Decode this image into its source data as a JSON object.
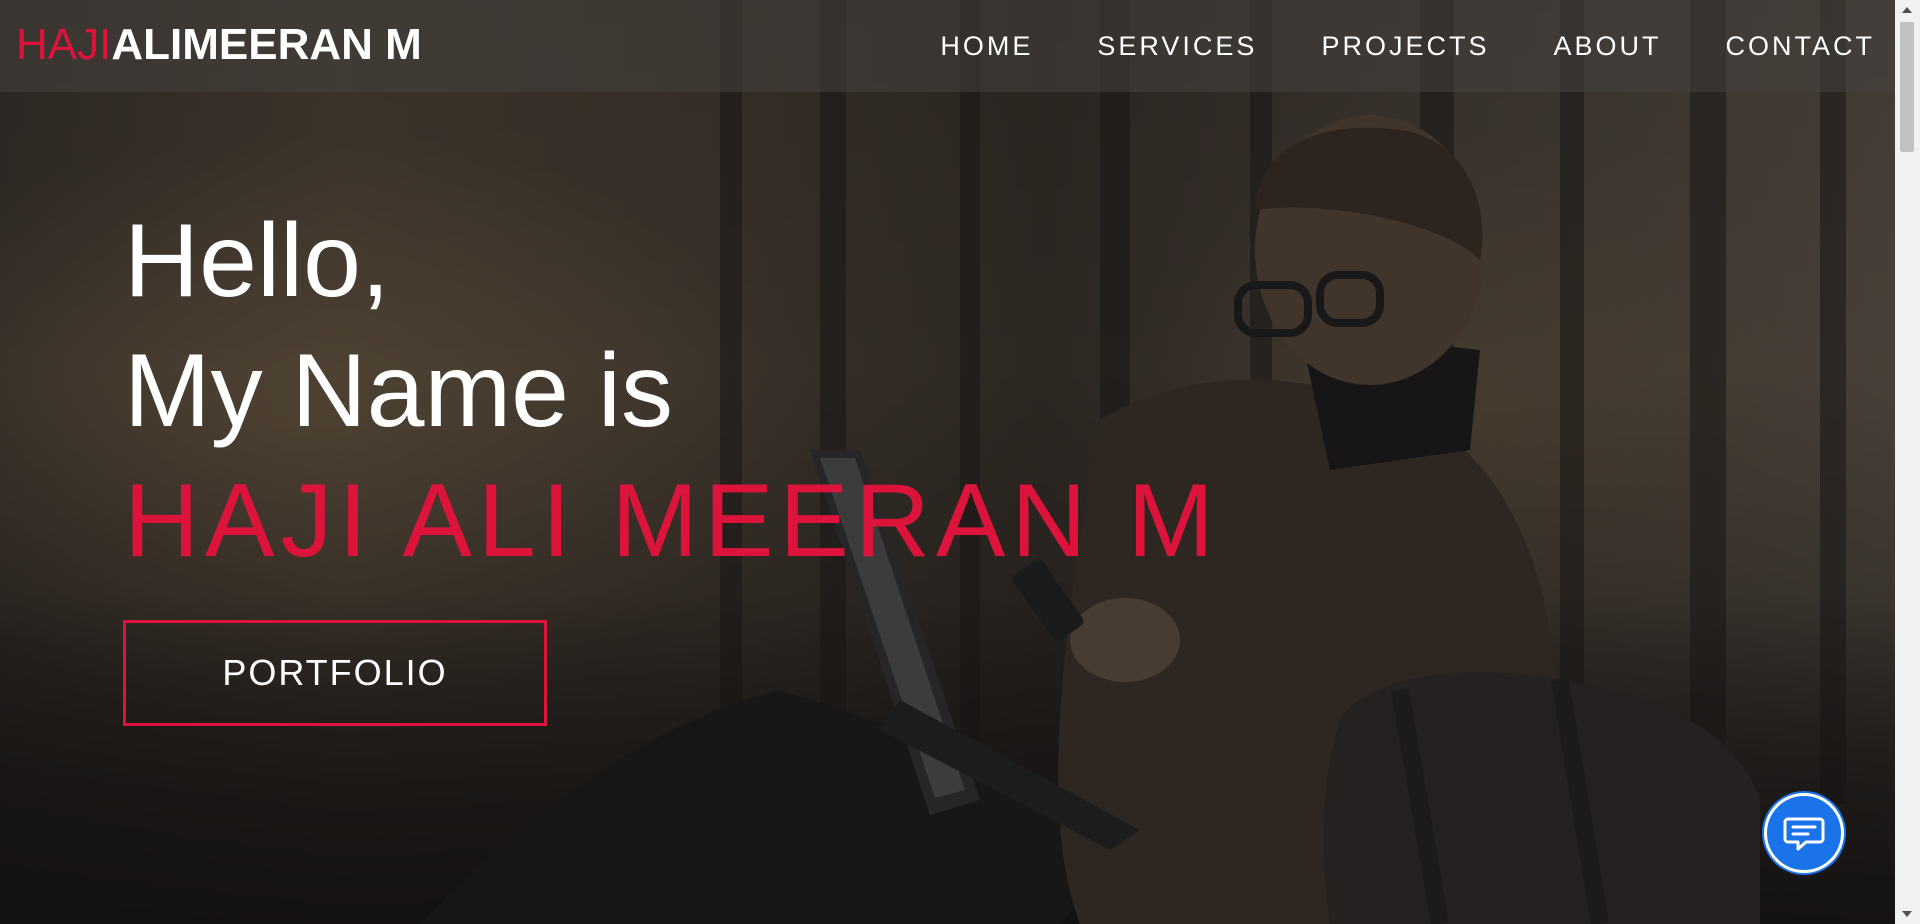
{
  "brand": {
    "accent": "HAJI",
    "rest": "ALIMEERAN M"
  },
  "nav": {
    "items": [
      {
        "label": "HOME"
      },
      {
        "label": "SERVICES"
      },
      {
        "label": "PROJECTS"
      },
      {
        "label": "ABOUT"
      },
      {
        "label": "CONTACT"
      }
    ]
  },
  "hero": {
    "line1": "Hello,",
    "line2": "My Name is",
    "name": "HAJI ALI MEERAN M",
    "button_label": "PORTFOLIO"
  },
  "chat": {
    "icon": "chat-icon"
  },
  "colors": {
    "accent": "#dc143c",
    "text": "#ffffff",
    "chat_button": "#1a73e8"
  }
}
